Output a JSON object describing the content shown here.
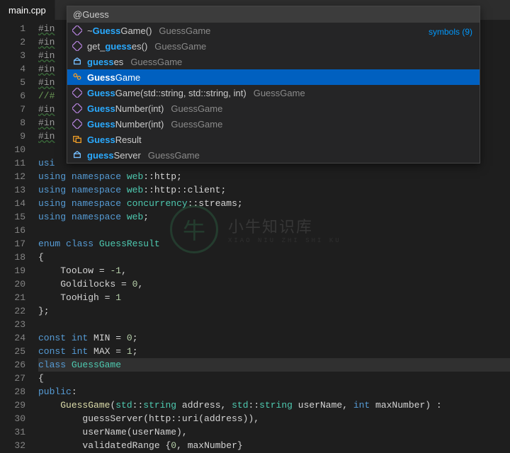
{
  "tab": {
    "filename": "main.cpp"
  },
  "search": {
    "query": "@Guess",
    "count_label": "symbols (9)"
  },
  "suggestions": [
    {
      "icon": "method",
      "pre": "~",
      "match": "Guess",
      "post": "Game()",
      "detail": "GuessGame",
      "selected": false
    },
    {
      "icon": "method",
      "pre": "get_",
      "match": "guess",
      "post": "es()",
      "detail": "GuessGame",
      "selected": false
    },
    {
      "icon": "field",
      "pre": "",
      "match": "guess",
      "post": "es",
      "detail": "GuessGame",
      "selected": false
    },
    {
      "icon": "class",
      "pre": "",
      "match": "Guess",
      "post": "Game",
      "detail": "",
      "selected": true
    },
    {
      "icon": "method",
      "pre": "",
      "match": "Guess",
      "post": "Game(std::string, std::string, int)",
      "detail": "GuessGame",
      "selected": false
    },
    {
      "icon": "method",
      "pre": "",
      "match": "Guess",
      "post": "Number(int)",
      "detail": "GuessGame",
      "selected": false
    },
    {
      "icon": "method",
      "pre": "",
      "match": "Guess",
      "post": "Number(int)",
      "detail": "GuessGame",
      "selected": false
    },
    {
      "icon": "enum",
      "pre": "",
      "match": "Guess",
      "post": "Result",
      "detail": "",
      "selected": false
    },
    {
      "icon": "field",
      "pre": "",
      "match": "guess",
      "post": "Server",
      "detail": "GuessGame",
      "selected": false
    }
  ],
  "code": {
    "lines": [
      {
        "n": 1,
        "t": "pp",
        "text": "#in"
      },
      {
        "n": 2,
        "t": "pp",
        "text": "#in"
      },
      {
        "n": 3,
        "t": "pp",
        "text": "#in"
      },
      {
        "n": 4,
        "t": "pp",
        "text": "#in"
      },
      {
        "n": 5,
        "t": "pp",
        "text": "#in"
      },
      {
        "n": 6,
        "t": "cmt",
        "text": "//#"
      },
      {
        "n": 7,
        "t": "pp",
        "text": "#in"
      },
      {
        "n": 8,
        "t": "pp",
        "text": "#in"
      },
      {
        "n": 9,
        "t": "pp",
        "text": "#in"
      },
      {
        "n": 10,
        "t": "blank",
        "text": ""
      },
      {
        "n": 11,
        "t": "using",
        "ns": ""
      },
      {
        "n": 12,
        "t": "using",
        "ns": "web",
        "tail": "::http;"
      },
      {
        "n": 13,
        "t": "using",
        "ns": "web",
        "tail": "::http::client;"
      },
      {
        "n": 14,
        "t": "using",
        "ns": "concurrency",
        "tail": "::streams;"
      },
      {
        "n": 15,
        "t": "using",
        "ns": "web",
        "tail": ";"
      },
      {
        "n": 16,
        "t": "blank",
        "text": ""
      },
      {
        "n": 17,
        "t": "enum_decl",
        "name": "GuessResult"
      },
      {
        "n": 18,
        "t": "raw",
        "text": "{"
      },
      {
        "n": 19,
        "t": "enum_v",
        "name": "TooLow",
        "val": "-1"
      },
      {
        "n": 20,
        "t": "enum_v",
        "name": "Goldilocks",
        "val": "0"
      },
      {
        "n": 21,
        "t": "enum_v",
        "name": "TooHigh",
        "val": "1",
        "last": true
      },
      {
        "n": 22,
        "t": "raw",
        "text": "};"
      },
      {
        "n": 23,
        "t": "blank",
        "text": ""
      },
      {
        "n": 24,
        "t": "const",
        "name": "MIN",
        "val": "0"
      },
      {
        "n": 25,
        "t": "const",
        "name": "MAX",
        "val": "1"
      },
      {
        "n": 26,
        "t": "class",
        "name": "GuessGame",
        "hl": true
      },
      {
        "n": 27,
        "t": "raw",
        "text": "{"
      },
      {
        "n": 28,
        "t": "public"
      },
      {
        "n": 29,
        "t": "ctor_sig"
      },
      {
        "n": 30,
        "t": "init",
        "text": "guessServer(http::uri(address)),"
      },
      {
        "n": 31,
        "t": "init",
        "text": "userName(userName),"
      },
      {
        "n": 32,
        "t": "init_last"
      }
    ]
  },
  "watermark": {
    "cn": "小牛知识库",
    "en": "XIAO NIU ZHI SHI KU"
  },
  "icon_colors": {
    "method": "#b180d7",
    "field": "#75beff",
    "class": "#ee9d28",
    "enum": "#ee9d28"
  }
}
